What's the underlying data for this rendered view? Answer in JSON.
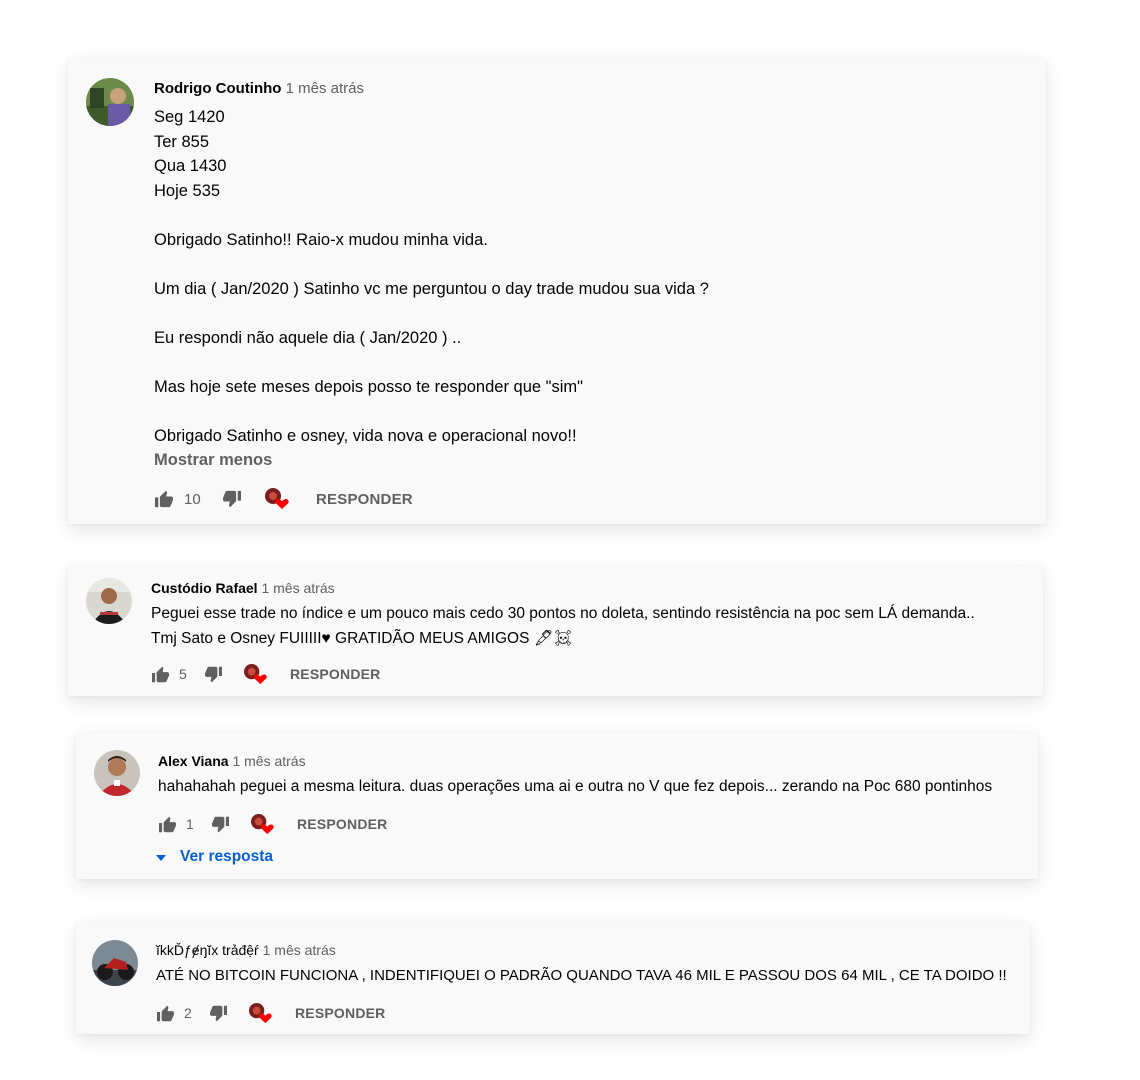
{
  "comments": [
    {
      "author": "Rodrigo Coutinho",
      "time": "1 mês atrás",
      "lines": [
        "Seg 1420",
        "Ter 855",
        "Qua 1430",
        "Hoje 535",
        "",
        "Obrigado Satinho!! Raio-x mudou minha vida.",
        "",
        "Um dia ( Jan/2020 ) Satinho vc me perguntou o day trade mudou sua vida ?",
        "",
        "Eu respondi não aquele dia ( Jan/2020 ) ..",
        "",
        "Mas hoje sete meses depois posso te responder que \"sim\"",
        "",
        "Obrigado Satinho e osney, vida nova e operacional novo!!"
      ],
      "show_less": "Mostrar menos",
      "likes": "10",
      "reply_label": "RESPONDER"
    },
    {
      "author": "Custódio Rafael",
      "time": "1 mês atrás",
      "lines": [
        "Peguei esse trade no índice e um pouco mais cedo 30 pontos no doleta, sentindo resistência na poc sem LÁ demanda..",
        "Tmj Sato e Osney FUIIIII♥ GRATIDÃO MEUS AMIGOS 🖋☠"
      ],
      "likes": "5",
      "reply_label": "RESPONDER"
    },
    {
      "author": "Alex Viana",
      "time": "1 mês atrás",
      "lines": [
        "hahahahah peguei a mesma leitura. duas operações uma ai e outra no V que fez depois... zerando na Poc 680 pontinhos"
      ],
      "likes": "1",
      "reply_label": "RESPONDER",
      "view_replies": "Ver resposta"
    },
    {
      "author": "ĭkkĎƒɇŋĭx trảđệŕ",
      "time": "1 mês atrás",
      "lines": [
        "ATÉ NO BITCOIN FUNCIONA , INDENTIFIQUEI O PADRÃO QUANDO TAVA 46 MIL E PASSOU DOS 64 MIL , CE TA DOIDO !!"
      ],
      "likes": "2",
      "reply_label": "RESPONDER"
    }
  ],
  "icons": {
    "like": "thumbs-up-icon",
    "dislike": "thumbs-down-icon",
    "creator_heart": "creator-heart-icon",
    "expand": "caret-down-icon"
  },
  "colors": {
    "link": "#065fd4",
    "heart": "#ff0000",
    "muted": "#606060",
    "card": "#f9f9f9"
  }
}
